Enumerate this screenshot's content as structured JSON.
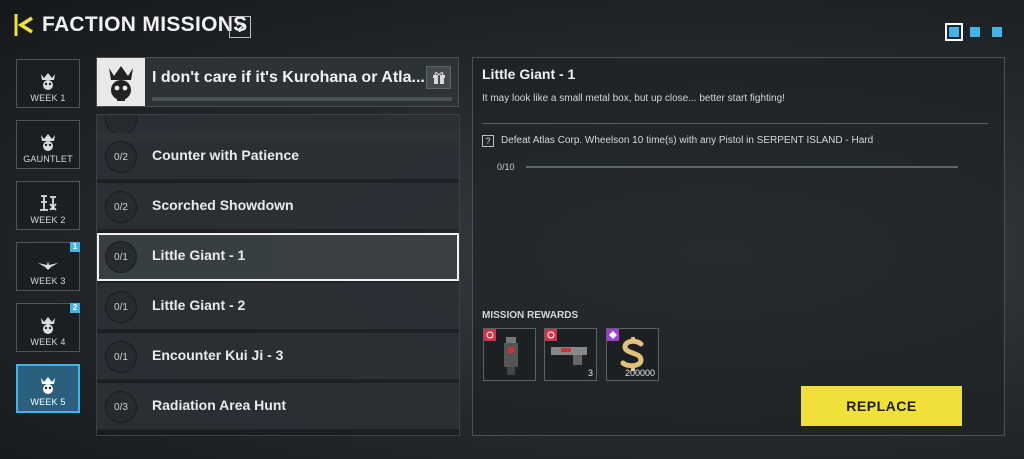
{
  "header": {
    "title": "FACTION MISSIONS",
    "help_symbol": "?",
    "back_icon": "back-arrow-icon",
    "accent_color": "#f2e03a",
    "page_dots": 3,
    "active_page": 1
  },
  "sidebar": {
    "items": [
      {
        "label": "WEEK 1",
        "badge": "",
        "selected": false
      },
      {
        "label": "GAUNTLET",
        "badge": "",
        "selected": false
      },
      {
        "label": "WEEK 2",
        "badge": "",
        "selected": false
      },
      {
        "label": "WEEK 3",
        "badge": "1",
        "selected": false
      },
      {
        "label": "WEEK 4",
        "badge": "2",
        "selected": false
      },
      {
        "label": "WEEK 5",
        "badge": "",
        "selected": true
      }
    ],
    "selected_color": "#3eb6ea"
  },
  "faction": {
    "name": "I don't care if it's Kurohana or Atla...",
    "gift_icon": "gift-icon",
    "logo_icon": "skull-crown-icon"
  },
  "missions": [
    {
      "progress": "0/2",
      "name": "Counter with Patience",
      "selected": false
    },
    {
      "progress": "0/2",
      "name": "Scorched Showdown",
      "selected": false
    },
    {
      "progress": "0/1",
      "name": "Little Giant - 1",
      "selected": true
    },
    {
      "progress": "0/1",
      "name": "Little Giant - 2",
      "selected": false
    },
    {
      "progress": "0/1",
      "name": "Encounter Kui Ji - 3",
      "selected": false
    },
    {
      "progress": "0/3",
      "name": "Radiation Area Hunt",
      "selected": false
    }
  ],
  "detail": {
    "title": "Little Giant - 1",
    "description": "It may look like a small metal box, but up close... better start fighting!",
    "objective_help": "?",
    "objective": "Defeat Atlas Corp. Wheelson 10 time(s) with any Pistol in SERPENT ISLAND - Hard",
    "objective_progress": "0/10",
    "objective_fraction": 0,
    "rewards_label": "MISSION REWARDS",
    "rewards": [
      {
        "icon": "weapon-blueprint-icon",
        "count": "",
        "rarity_color": "#d0344a"
      },
      {
        "icon": "pistol-icon",
        "count": "3",
        "rarity_color": "#d0344a"
      },
      {
        "icon": "cod-points-icon",
        "count": "200000",
        "rarity_color": "#a23fd6"
      }
    ],
    "replace_label": "REPLACE"
  }
}
